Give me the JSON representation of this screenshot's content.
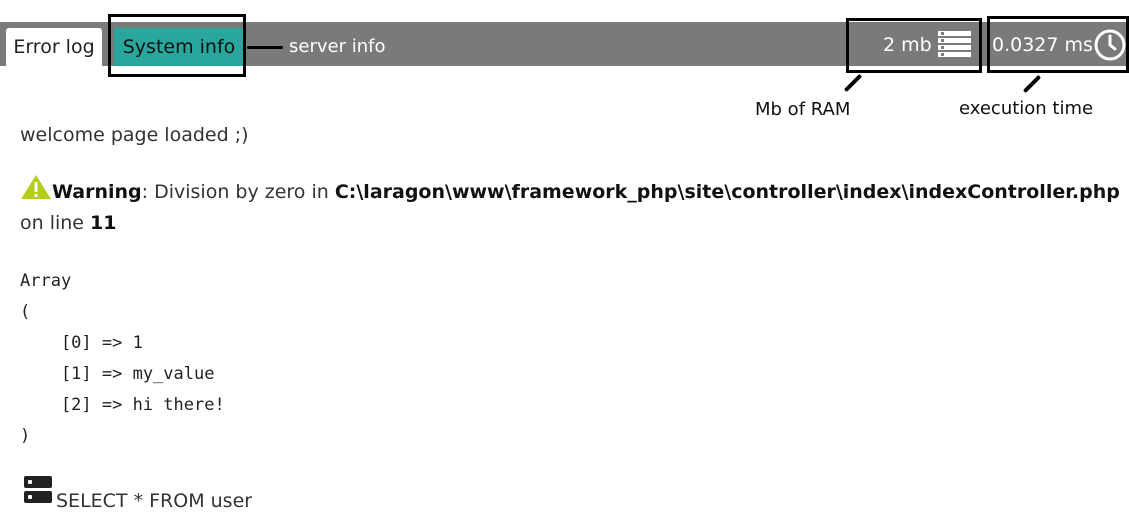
{
  "toolbar": {
    "tabs": [
      {
        "label": "Error log"
      },
      {
        "label": "System info"
      }
    ],
    "server_info_label": "server info",
    "ram": {
      "value": "2 mb",
      "icon": "server-stack-icon"
    },
    "execution": {
      "value": "0.0327 ms",
      "icon": "clock-icon"
    },
    "colors": {
      "bar": "#7a7a7a",
      "active_tab": "#2aa79c"
    }
  },
  "annotations": {
    "ram_label": "Mb of RAM",
    "exec_label": "execution time"
  },
  "output": {
    "welcome": "welcome page loaded ;)",
    "warning": {
      "icon": "warning-triangle-icon",
      "title": "Warning",
      "message": ": Division by zero in ",
      "file": "C:\\laragon\\www\\framework_php\\site\\controller\\index\\indexController.php",
      "on_line_text": " on line ",
      "line": "11"
    },
    "array_dump": "Array\n(\n    [0] => 1\n    [1] => my_value\n    [2] => hi there!\n)",
    "query": {
      "icon": "database-icon",
      "sql": "SELECT * FROM user"
    }
  }
}
